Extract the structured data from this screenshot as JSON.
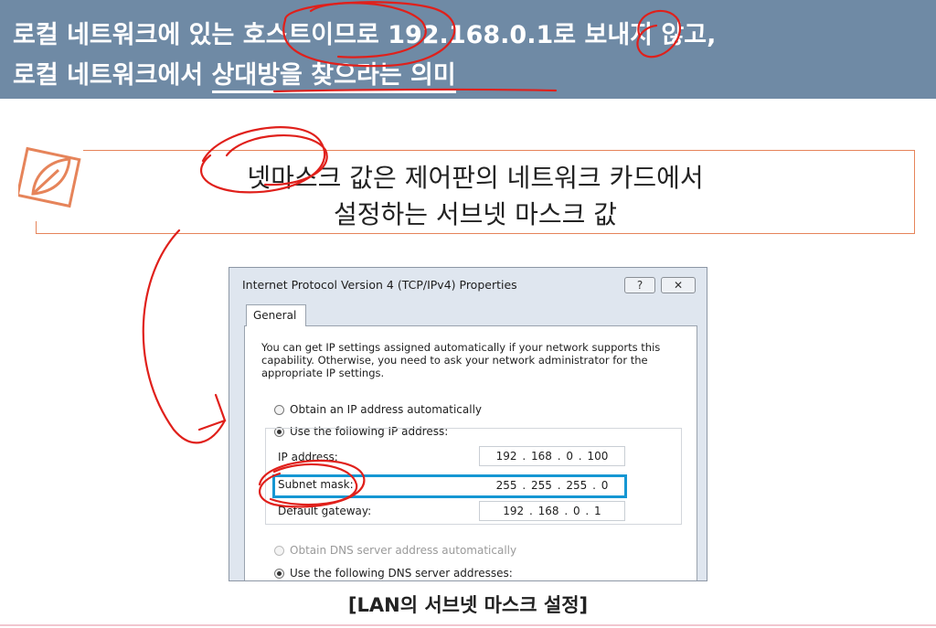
{
  "header": {
    "line1": "로컬 네트워크에 있는 호스트이므로 192.168.0.1로 보내지 않고,",
    "line2_prefix": "로컬 네트워크에서 ",
    "line2_underlined": "상대방을 찾으라는 의미"
  },
  "note": {
    "icon": "leaf-icon",
    "line1": "넷마스크 값은 제어판의 네트워크 카드에서",
    "line2": "설정하는 서브넷 마스크 값"
  },
  "dialog": {
    "title": "Internet Protocol Version 4 (TCP/IPv4) Properties",
    "help_label": "?",
    "close_label": "✕",
    "tab_general": "General",
    "intro": "You can get IP settings assigned automatically if your network supports this capability. Otherwise, you need to ask your network administrator for the appropriate IP settings.",
    "radio_auto_ip": "Obtain an IP address automatically",
    "radio_manual_ip": "Use the following IP address:",
    "ip_label": "IP address:",
    "ip_value": "192 . 168 .  0  . 100",
    "subnet_label": "Subnet mask:",
    "subnet_value": "255 . 255 . 255 .  0",
    "gateway_label": "Default gateway:",
    "gateway_value": "192 . 168 .  0  .  1",
    "radio_auto_dns": "Obtain DNS server address automatically",
    "radio_manual_dns": "Use the following DNS server addresses:"
  },
  "caption": "[LAN의 서브넷 마스크 설정]",
  "colors": {
    "header_bg": "#6f8aa5",
    "note_border": "#e6845a",
    "highlight": "#1597d3",
    "annotation": "#e0201b"
  }
}
